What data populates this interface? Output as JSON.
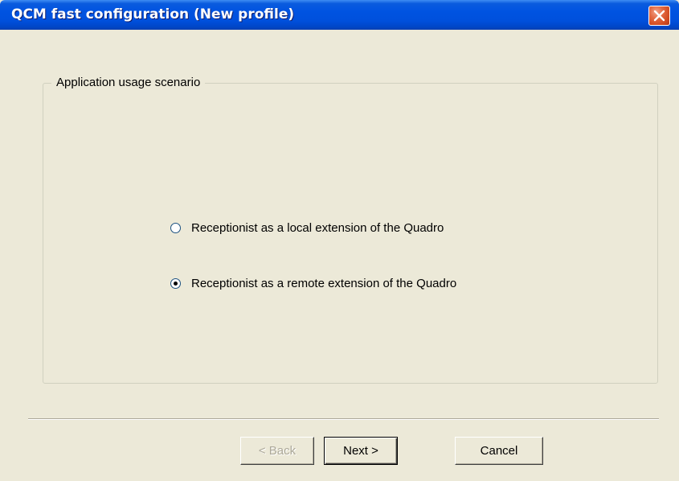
{
  "window": {
    "title": "QCM fast configuration (New profile)"
  },
  "groupbox": {
    "label": "Application usage scenario"
  },
  "options": [
    {
      "label": "Receptionist as a local extension of the Quadro",
      "selected": false
    },
    {
      "label": "Receptionist as a remote extension of the Quadro",
      "selected": true
    }
  ],
  "buttons": {
    "back": "< Back",
    "next": "Next >",
    "cancel": "Cancel"
  },
  "icons": {
    "close": "close-icon"
  },
  "colors": {
    "titlebar": "#0053E1",
    "close_button": "#D24C22",
    "dialog_bg": "#ECE9D8"
  }
}
